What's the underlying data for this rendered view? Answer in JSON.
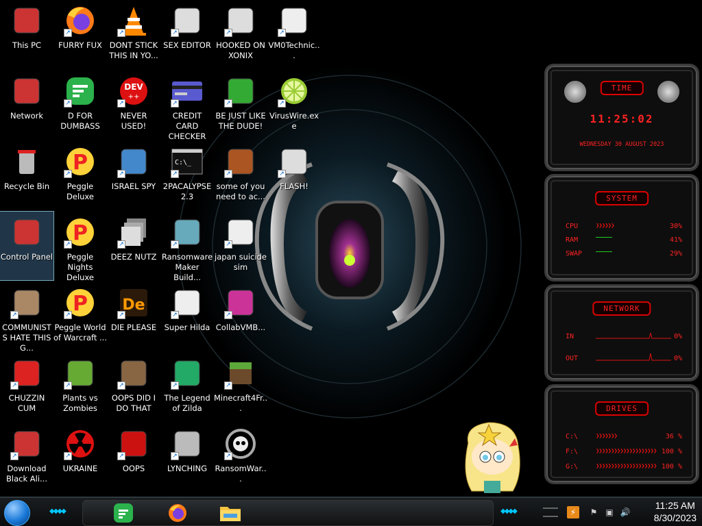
{
  "desktop": {
    "icons": [
      {
        "label": "This PC"
      },
      {
        "label": "FURRY FUX"
      },
      {
        "label": "DONT STICK THIS IN YO..."
      },
      {
        "label": "SEX EDITOR"
      },
      {
        "label": "HOOKED ON XONIX"
      },
      {
        "label": "VM0Technic..."
      },
      {
        "label": "Network"
      },
      {
        "label": "D FOR DUMBASS"
      },
      {
        "label": "NEVER USED!"
      },
      {
        "label": "CREDIT CARD CHECKER"
      },
      {
        "label": "BE JUST LIKE THE DUDE!"
      },
      {
        "label": "VirusWire.exe"
      },
      {
        "label": "Recycle Bin"
      },
      {
        "label": "Peggle Deluxe"
      },
      {
        "label": "ISRAEL SPY"
      },
      {
        "label": "2PACALYPSE 2.3"
      },
      {
        "label": "some of you need to ac..."
      },
      {
        "label": "FLASH!"
      },
      {
        "label": "Control Panel"
      },
      {
        "label": "Peggle Nights Deluxe"
      },
      {
        "label": "DEEZ NUTZ"
      },
      {
        "label": "Ransomware Maker Build..."
      },
      {
        "label": "japan suicide sim"
      },
      {
        "label": "COMMUNISTS HATE THIS G..."
      },
      {
        "label": "Peggle World of Warcraft ..."
      },
      {
        "label": "DIE PLEASE"
      },
      {
        "label": "Super Hilda"
      },
      {
        "label": "CollabVMB..."
      },
      {
        "label": "CHUZZIN CUM"
      },
      {
        "label": "Plants vs Zombies"
      },
      {
        "label": "OOPS DID I DO THAT"
      },
      {
        "label": "The Legend of Zilda"
      },
      {
        "label": "Minecraft4Fr..."
      },
      {
        "label": "Download Black Ali..."
      },
      {
        "label": "UKRAINE"
      },
      {
        "label": "OOPS"
      },
      {
        "label": "LYNCHING"
      },
      {
        "label": "RansomWar..."
      }
    ],
    "dev_icon_text": "DEV",
    "de_icon_text": "De",
    "cmd_icon_text": "C:\\_",
    "shortcut_glyph": "↗"
  },
  "gadgets": {
    "time": {
      "title": "TIME",
      "clock": "11:25:02",
      "date": "WEDNESDAY 30 AUGUST 2023"
    },
    "system": {
      "title": "SYSTEM",
      "rows": [
        {
          "key": "CPU",
          "pct": "30%"
        },
        {
          "key": "RAM",
          "pct": "41%"
        },
        {
          "key": "SWAP",
          "pct": "29%"
        }
      ]
    },
    "network": {
      "title": "NETWORK",
      "rows": [
        {
          "key": "IN",
          "pct": "0%"
        },
        {
          "key": "OUT",
          "pct": "0%"
        }
      ]
    },
    "drives": {
      "title": "DRIVES",
      "rows": [
        {
          "key": "C:\\",
          "pct": "36 %"
        },
        {
          "key": "F:\\",
          "pct": "100 %"
        },
        {
          "key": "G:\\",
          "pct": "100 %"
        }
      ]
    }
  },
  "taskbar": {
    "clock_time": "11:25 AM",
    "clock_date": "8/30/2023"
  },
  "colors": {
    "accent": "#ff2222",
    "taskbar": "#0f1214",
    "glow": "#00c8ff"
  }
}
